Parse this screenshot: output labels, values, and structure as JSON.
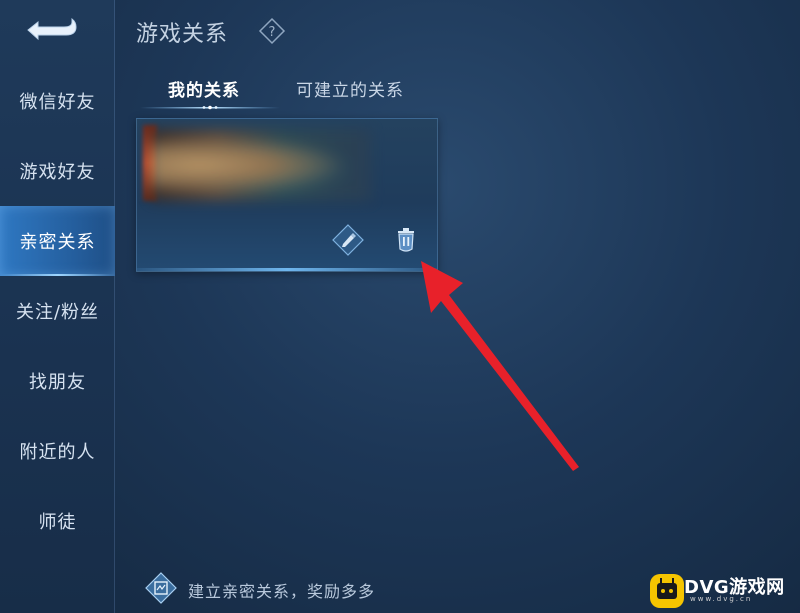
{
  "header": {
    "back_icon": "back-arrow-icon",
    "title": "游戏关系",
    "help_icon": "question-diamond-icon"
  },
  "sidebar": {
    "items": [
      {
        "label": "微信好友",
        "active": false
      },
      {
        "label": "游戏好友",
        "active": false
      },
      {
        "label": "亲密关系",
        "active": true
      },
      {
        "label": "关注/粉丝",
        "active": false
      },
      {
        "label": "找朋友",
        "active": false
      },
      {
        "label": "附近的人",
        "active": false
      },
      {
        "label": "师徒",
        "active": false
      }
    ]
  },
  "tabs": [
    {
      "label": "我的关系",
      "active": true
    },
    {
      "label": "可建立的关系",
      "active": false
    }
  ],
  "relationship_card": {
    "avatar": "blurred",
    "edit_icon": "pencil-icon",
    "delete_icon": "trash-icon"
  },
  "annotation": {
    "arrow_color": "#e8212a",
    "arrow_target": "delete-button"
  },
  "footer": {
    "icon": "relationship-badge-icon",
    "text": "建立亲密关系，奖励多多"
  },
  "watermark": {
    "brand": "DVG游戏网",
    "sub": "www.dvg.cn",
    "color": "#f5c400"
  }
}
